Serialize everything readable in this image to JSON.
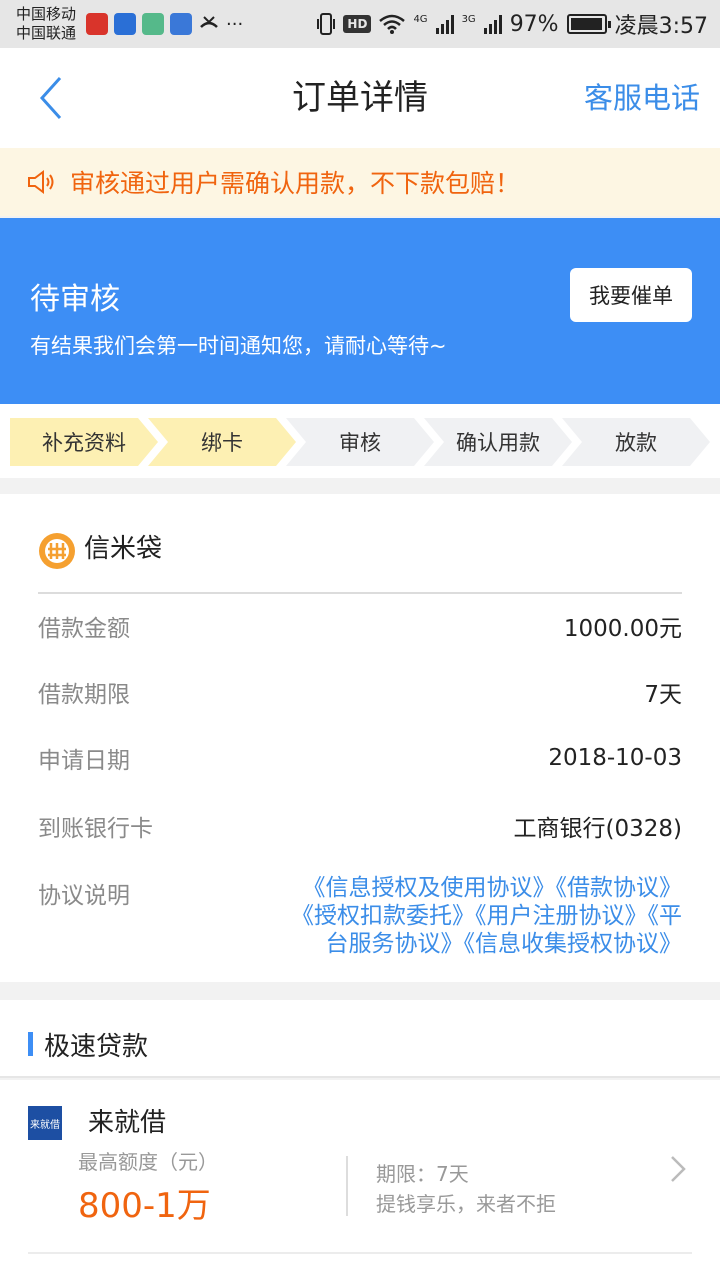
{
  "status_bar": {
    "carrier1": "中国移动",
    "carrier2": "中国联通",
    "more": "···",
    "hd": "HD",
    "net1": "4G",
    "net2": "3G",
    "battery_text": "97%",
    "battery_level": 0.97,
    "time": "凌晨3:57"
  },
  "header": {
    "back_icon": "chevron-left-icon",
    "title": "订单详情",
    "hotline": "客服电话"
  },
  "notice": {
    "icon": "speaker-icon",
    "text": "审核通过用户需确认用款，不下款包赔！"
  },
  "status": {
    "title": "待审核",
    "description": "有结果我们会第一时间通知您，请耐心等待~",
    "urge_button": "我要催单"
  },
  "steps": [
    {
      "label": "补充资料",
      "done": true
    },
    {
      "label": "绑卡",
      "done": true
    },
    {
      "label": "审核",
      "done": false
    },
    {
      "label": "确认用款",
      "done": false
    },
    {
      "label": "放款",
      "done": false
    }
  ],
  "order": {
    "lender": "信米袋",
    "rows": [
      {
        "label": "借款金额",
        "value": "1000.00元"
      },
      {
        "label": "借款期限",
        "value": "7天"
      },
      {
        "label": "申请日期",
        "value": "2018-10-03"
      },
      {
        "label": "到账银行卡",
        "value": "工商银行(0328)"
      }
    ],
    "agreement_label": "协议说明",
    "agreements_line1": "《信息授权及使用协议》《借款协议》",
    "agreements_line2": "《授权扣款委托》《用户注册协议》《平",
    "agreements_line3": "台服务协议》《信息收集授权协议》"
  },
  "quick_loan": {
    "section_title": "极速贷款",
    "product": {
      "logo_text": "来就借",
      "name": "来就借",
      "quota_label": "最高额度（元）",
      "quota_value": "800-1万",
      "term": "期限：7天",
      "slogan": "提钱享乐，来者不拒"
    }
  },
  "colors": {
    "accent_blue": "#3d8ef5",
    "link_blue": "#3b8de8",
    "orange": "#f0640f",
    "step_done": "#fdf0b3",
    "step_pending": "#f0f1f3"
  }
}
